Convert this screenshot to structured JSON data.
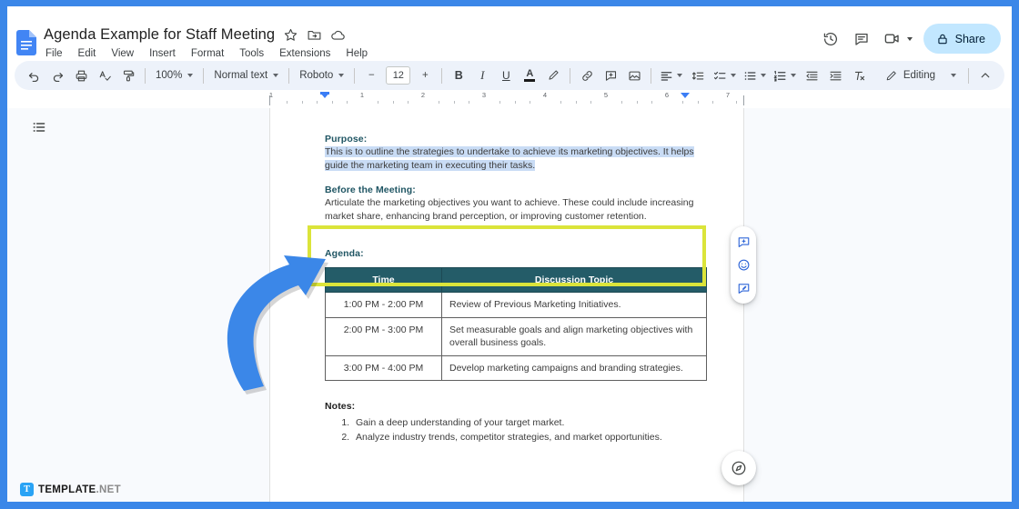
{
  "app": {
    "name": "Google Docs",
    "logo_icon": "docs-file-icon"
  },
  "header": {
    "doc_title": "Agenda Example for Staff Meeting",
    "title_actions": [
      {
        "name": "star-icon",
        "label": "Star"
      },
      {
        "name": "move-folder-icon",
        "label": "Move"
      },
      {
        "name": "cloud-saved-icon",
        "label": "Saved to Drive"
      }
    ],
    "menus": [
      "File",
      "Edit",
      "View",
      "Insert",
      "Format",
      "Tools",
      "Extensions",
      "Help"
    ],
    "right_actions": [
      {
        "name": "version-history-icon",
        "label": "Last edit"
      },
      {
        "name": "comment-history-icon",
        "label": "Open comment history"
      },
      {
        "name": "meet-camera-icon",
        "label": "Join a call"
      }
    ],
    "share_label": "Share",
    "share_icon": "lock-icon",
    "share_bg": "#c2e7ff"
  },
  "toolbar": {
    "undo": "undo-icon",
    "redo": "redo-icon",
    "print": "print-icon",
    "spellcheck": "spellcheck-icon",
    "paint_format": "paint-format-icon",
    "zoom_value": "100%",
    "style_value": "Normal text",
    "font_value": "Roboto",
    "font_decrease": "−",
    "font_size": "12",
    "font_increase": "+",
    "bold": "B",
    "italic": "I",
    "underline": "U",
    "text_color": "A",
    "highlight_icon": "highlight-pen-icon",
    "link_icon": "link-icon",
    "comment_icon": "add-comment-icon",
    "image_icon": "insert-image-icon",
    "align_icon": "align-left-icon",
    "line_spacing_icon": "line-spacing-icon",
    "checklist_icon": "checklist-icon",
    "bulleted_icon": "bulleted-list-icon",
    "numbered_icon": "numbered-list-icon",
    "indent_less_icon": "decrease-indent-icon",
    "indent_more_icon": "increase-indent-icon",
    "clear_format_icon": "clear-formatting-icon",
    "editing_mode": "Editing",
    "editing_icon": "pencil-icon",
    "collapse_icon": "chevron-up-icon"
  },
  "ruler": {
    "numbers": [
      "1",
      "1",
      "2",
      "3",
      "4",
      "5",
      "6",
      "7"
    ],
    "unit": "inches"
  },
  "workspace": {
    "outline_icon": "document-outline-icon",
    "fab_icon": "explore-icon"
  },
  "document": {
    "sections": [
      {
        "heading": "Purpose:",
        "body": "This is to outline the strategies to undertake to achieve its marketing objectives. It helps guide the marketing team in executing their tasks.",
        "selected": true,
        "highlighted": true
      },
      {
        "heading": "Before the Meeting:",
        "body": "Articulate the marketing objectives you want to achieve. These could include increasing market share, enhancing brand perception, or improving customer retention.",
        "selected": false,
        "highlighted": false
      }
    ],
    "agenda_heading": "Agenda:",
    "table": {
      "header_bg": "#245c68",
      "columns": [
        "Time",
        "Discussion Topic"
      ],
      "rows": [
        [
          "1:00 PM - 2:00 PM",
          "Review of Previous Marketing Initiatives."
        ],
        [
          "2:00 PM - 3:00 PM",
          "Set measurable goals and align marketing objectives with overall business goals."
        ],
        [
          "3:00 PM - 4:00 PM",
          "Develop marketing campaigns and branding strategies."
        ]
      ]
    },
    "notes_heading": "Notes:",
    "notes": [
      "Gain a deep understanding of your target market.",
      "Analyze industry trends, competitor strategies, and market opportunities."
    ],
    "heading_color": "#1f5563",
    "selection_color": "#c9dcf5",
    "highlight_border_color": "#dbe43a"
  },
  "comment_rail": {
    "buttons": [
      {
        "name": "add-comment-icon",
        "label": "Add comment"
      },
      {
        "name": "add-emoji-reaction-icon",
        "label": "Add emoji reaction"
      },
      {
        "name": "suggest-edit-icon",
        "label": "Suggest edits"
      }
    ]
  },
  "annotation": {
    "arrow_color": "#3b87e8",
    "arrow_name": "curved-up-right-arrow"
  },
  "watermark": {
    "logo_letter": "T",
    "text_bold": "TEMPLATE",
    "text_dim": ".NET"
  },
  "frame": {
    "border_color": "#3b87e8"
  }
}
